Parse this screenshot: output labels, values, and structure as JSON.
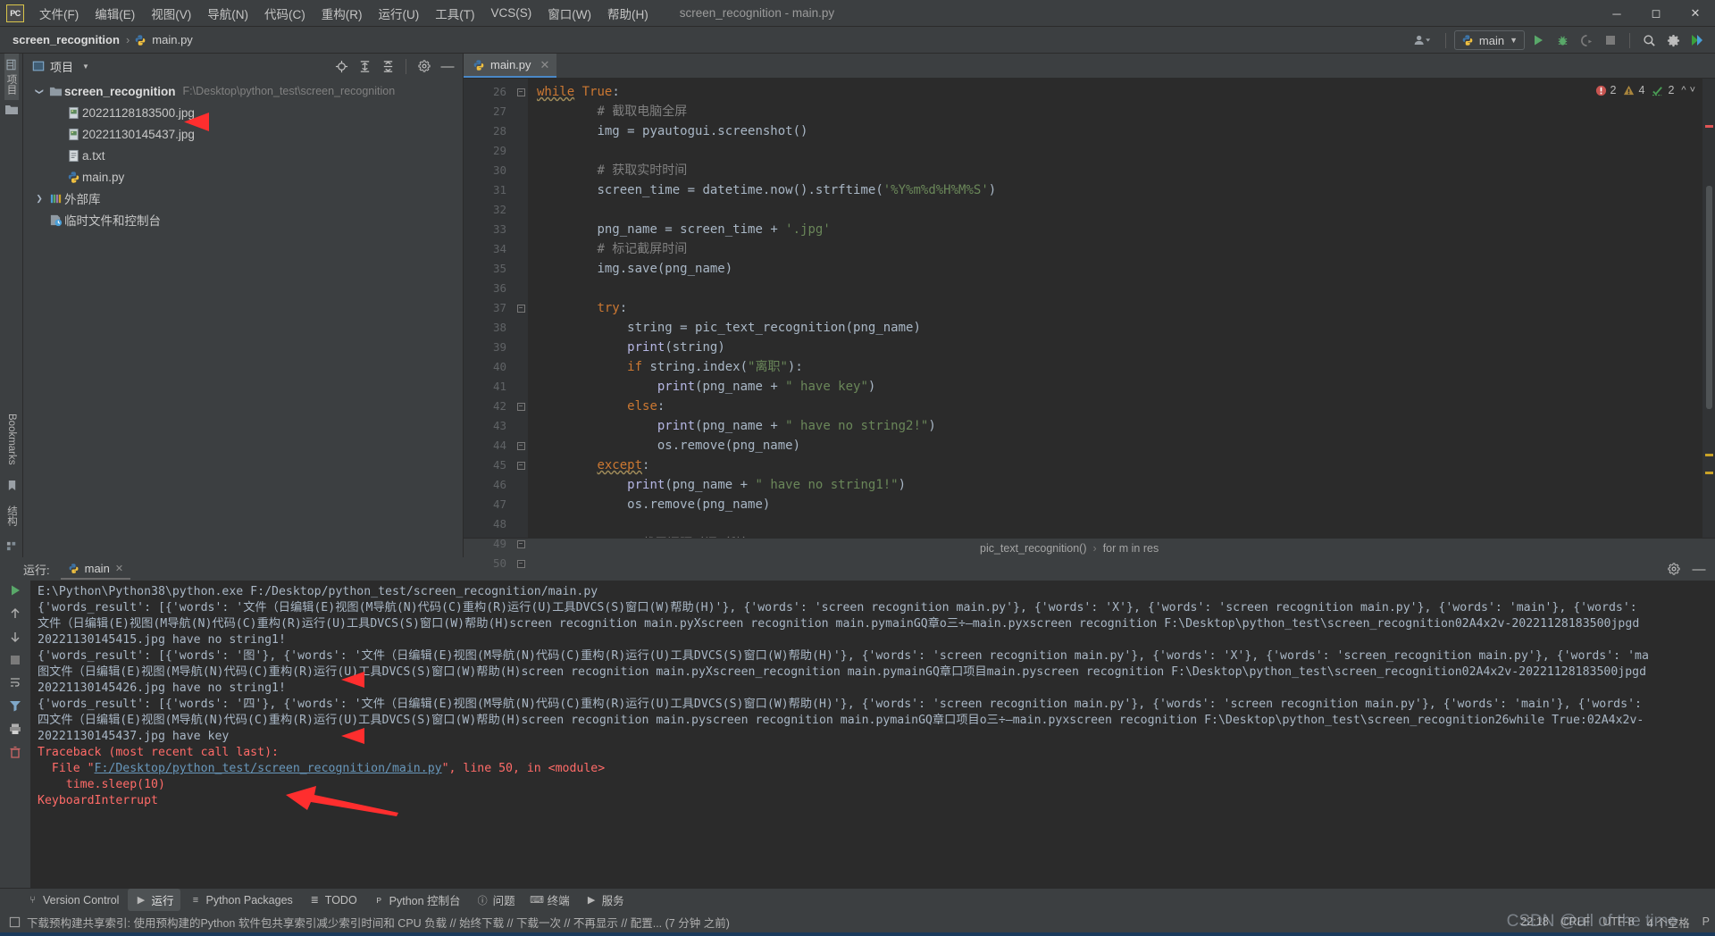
{
  "window": {
    "app_icon": "pycharm-logo-icon",
    "title": "screen_recognition - main.py",
    "controls": [
      "minimize",
      "maximize",
      "close"
    ]
  },
  "menubar": {
    "items": [
      {
        "label": "文件(F)",
        "name": "menu-file"
      },
      {
        "label": "编辑(E)",
        "name": "menu-edit"
      },
      {
        "label": "视图(V)",
        "name": "menu-view"
      },
      {
        "label": "导航(N)",
        "name": "menu-navigate"
      },
      {
        "label": "代码(C)",
        "name": "menu-code"
      },
      {
        "label": "重构(R)",
        "name": "menu-refactor"
      },
      {
        "label": "运行(U)",
        "name": "menu-run"
      },
      {
        "label": "工具(T)",
        "name": "menu-tools"
      },
      {
        "label": "VCS(S)",
        "name": "menu-vcs"
      },
      {
        "label": "窗口(W)",
        "name": "menu-window"
      },
      {
        "label": "帮助(H)",
        "name": "menu-help"
      }
    ]
  },
  "navbar": {
    "breadcrumb": [
      {
        "label": "screen_recognition",
        "icon": ""
      },
      {
        "label": "main.py",
        "icon": "python-file-icon"
      }
    ],
    "separator": "›",
    "run_config": "main",
    "run_config_icon": "python-icon",
    "icons": [
      "account-icon",
      "run-icon",
      "debug-icon",
      "run-with-coverage-icon",
      "stop-icon",
      "search-icon",
      "settings-icon",
      "updates-icon"
    ]
  },
  "left_strip": {
    "tabs": [
      {
        "label": "项目",
        "name": "strip-tab-project",
        "active": true
      }
    ],
    "bottom": [
      {
        "label": "Bookmarks",
        "name": "strip-tab-bookmarks"
      },
      {
        "label": "结构",
        "name": "strip-tab-structure"
      }
    ]
  },
  "project_panel": {
    "title": "项目",
    "title_icon": "project-icon",
    "dropdown_icon": "chevron-down-icon",
    "actions": [
      "locate-icon",
      "expand-all-icon",
      "collapse-all-icon",
      "settings-icon",
      "hide-icon"
    ],
    "tree": [
      {
        "label": "screen_recognition",
        "path": "F:\\Desktop\\python_test\\screen_recognition",
        "icon": "folder-icon",
        "indent": 0,
        "twisty": "expanded",
        "bold": true
      },
      {
        "label": "20221128183500.jpg",
        "path": "",
        "icon": "image-file-icon",
        "indent": 1,
        "twisty": "none",
        "bold": false
      },
      {
        "label": "20221130145437.jpg",
        "path": "",
        "icon": "image-file-icon",
        "indent": 1,
        "twisty": "none",
        "bold": false
      },
      {
        "label": "a.txt",
        "path": "",
        "icon": "text-file-icon",
        "indent": 1,
        "twisty": "none",
        "bold": false
      },
      {
        "label": "main.py",
        "path": "",
        "icon": "python-file-icon",
        "indent": 1,
        "twisty": "none",
        "bold": false
      },
      {
        "label": "外部库",
        "path": "",
        "icon": "library-icon",
        "indent": 0,
        "twisty": "collapsed",
        "bold": false
      },
      {
        "label": "临时文件和控制台",
        "path": "",
        "icon": "scratches-icon",
        "indent": 0,
        "twisty": "none",
        "bold": false
      }
    ]
  },
  "editor": {
    "tabs": [
      {
        "label": "main.py",
        "icon": "python-file-icon",
        "active": true,
        "close_icon": "close-icon"
      }
    ],
    "inspection": {
      "errors": "2",
      "warnings": "4",
      "typos": "2",
      "error_icon": "error-icon",
      "warning_icon": "warning-icon",
      "typo_icon": "typo-icon",
      "up_icon": "chevron-up-icon",
      "down_icon": "chevron-down-icon"
    },
    "first_line_number": 26,
    "lines": [
      {
        "n": 26,
        "fold": "minus",
        "tokens": [
          {
            "t": "while",
            "c": "kw wavy"
          },
          {
            "t": " ",
            "c": "id"
          },
          {
            "t": "True",
            "c": "kw"
          },
          {
            "t": ":",
            "c": "id"
          }
        ],
        "indent": 0
      },
      {
        "n": 27,
        "fold": "",
        "tokens": [
          {
            "t": "# 截取电脑全屏",
            "c": "cmt"
          }
        ],
        "indent": 2
      },
      {
        "n": 28,
        "fold": "",
        "tokens": [
          {
            "t": "img ",
            "c": "id"
          },
          {
            "t": "= ",
            "c": "id"
          },
          {
            "t": "pyautogui",
            "c": "id"
          },
          {
            "t": ".screenshot()",
            "c": "id"
          }
        ],
        "indent": 2
      },
      {
        "n": 29,
        "fold": "",
        "tokens": [],
        "indent": 0
      },
      {
        "n": 30,
        "fold": "",
        "tokens": [
          {
            "t": "# 获取实时时间",
            "c": "cmt"
          }
        ],
        "indent": 2
      },
      {
        "n": 31,
        "fold": "",
        "tokens": [
          {
            "t": "screen_time ",
            "c": "id"
          },
          {
            "t": "= ",
            "c": "id"
          },
          {
            "t": "datetime.now().strftime(",
            "c": "id"
          },
          {
            "t": "'%Y%m%d%H%M%S'",
            "c": "str"
          },
          {
            "t": ")",
            "c": "id"
          }
        ],
        "indent": 2
      },
      {
        "n": 32,
        "fold": "",
        "tokens": [],
        "indent": 0
      },
      {
        "n": 33,
        "fold": "",
        "tokens": [
          {
            "t": "png_name ",
            "c": "id"
          },
          {
            "t": "= ",
            "c": "id"
          },
          {
            "t": "screen_time ",
            "c": "id"
          },
          {
            "t": "+ ",
            "c": "id"
          },
          {
            "t": "'.jpg'",
            "c": "str"
          }
        ],
        "indent": 2
      },
      {
        "n": 34,
        "fold": "",
        "tokens": [
          {
            "t": "# 标记截屏时间",
            "c": "cmt"
          }
        ],
        "indent": 2
      },
      {
        "n": 35,
        "fold": "",
        "tokens": [
          {
            "t": "img.save(png_name)",
            "c": "id"
          }
        ],
        "indent": 2
      },
      {
        "n": 36,
        "fold": "",
        "tokens": [],
        "indent": 0
      },
      {
        "n": 37,
        "fold": "minus",
        "tokens": [
          {
            "t": "try",
            "c": "kw"
          },
          {
            "t": ":",
            "c": "id"
          }
        ],
        "indent": 2
      },
      {
        "n": 38,
        "fold": "",
        "tokens": [
          {
            "t": "string ",
            "c": "id"
          },
          {
            "t": "= ",
            "c": "id"
          },
          {
            "t": "pic_text_recognition(png_name)",
            "c": "id"
          }
        ],
        "indent": 3
      },
      {
        "n": 39,
        "fold": "",
        "tokens": [
          {
            "t": "print",
            "c": "fn"
          },
          {
            "t": "(string)",
            "c": "id"
          }
        ],
        "indent": 3
      },
      {
        "n": 40,
        "fold": "",
        "tokens": [
          {
            "t": "if ",
            "c": "kw"
          },
          {
            "t": "string.index(",
            "c": "id"
          },
          {
            "t": "\"离职\"",
            "c": "str"
          },
          {
            "t": "):",
            "c": "id"
          }
        ],
        "indent": 3
      },
      {
        "n": 41,
        "fold": "",
        "tokens": [
          {
            "t": "print",
            "c": "fn"
          },
          {
            "t": "(png_name ",
            "c": "id"
          },
          {
            "t": "+ ",
            "c": "id"
          },
          {
            "t": "\" have key\"",
            "c": "str"
          },
          {
            "t": ")",
            "c": "id"
          }
        ],
        "indent": 4
      },
      {
        "n": 42,
        "fold": "minus",
        "tokens": [
          {
            "t": "else",
            "c": "kw"
          },
          {
            "t": ":",
            "c": "id"
          }
        ],
        "indent": 3
      },
      {
        "n": 43,
        "fold": "",
        "tokens": [
          {
            "t": "print",
            "c": "fn"
          },
          {
            "t": "(png_name ",
            "c": "id"
          },
          {
            "t": "+ ",
            "c": "id"
          },
          {
            "t": "\" have no string2!\"",
            "c": "str"
          },
          {
            "t": ")",
            "c": "id"
          }
        ],
        "indent": 4
      },
      {
        "n": 44,
        "fold": "minus",
        "tokens": [
          {
            "t": "os.remove(png_name)",
            "c": "id"
          }
        ],
        "indent": 4
      },
      {
        "n": 45,
        "fold": "minus",
        "tokens": [
          {
            "t": "except",
            "c": "kw wavy"
          },
          {
            "t": ":",
            "c": "id"
          }
        ],
        "indent": 2
      },
      {
        "n": 46,
        "fold": "",
        "tokens": [
          {
            "t": "print",
            "c": "fn"
          },
          {
            "t": "(png_name ",
            "c": "id"
          },
          {
            "t": "+ ",
            "c": "id"
          },
          {
            "t": "\" have no string1!\"",
            "c": "str"
          },
          {
            "t": ")",
            "c": "id"
          }
        ],
        "indent": 3
      },
      {
        "n": 47,
        "fold": "",
        "tokens": [
          {
            "t": "os.remove(png_name)",
            "c": "id"
          }
        ],
        "indent": 3
      },
      {
        "n": 48,
        "fold": "",
        "tokens": [],
        "indent": 0
      },
      {
        "n": 49,
        "fold": "minus",
        "tokens": [
          {
            "t": "# 截屏间隔时间（秒）",
            "c": "cmt"
          }
        ],
        "indent": 3
      },
      {
        "n": 50,
        "fold": "minus",
        "tokens": [
          {
            "t": "time.sleep(",
            "c": "id"
          },
          {
            "t": "10",
            "c": "num"
          },
          {
            "t": ")",
            "c": "id"
          }
        ],
        "indent": 2
      }
    ],
    "bottom_breadcrumb": [
      "pic_text_recognition()",
      "for m in res"
    ],
    "bottom_breadcrumb_sep": "›"
  },
  "run_panel": {
    "label": "运行:",
    "tab": "main",
    "tab_icon": "python-icon",
    "tab_close_icon": "close-icon",
    "head_actions": [
      "settings-icon",
      "hide-icon"
    ],
    "toolbar_icons": [
      "rerun-icon",
      "scroll-up-icon",
      "scroll-down-icon",
      "stop-icon",
      "wrap-text-icon",
      "filter-icon",
      "print-icon",
      "clear-all-icon"
    ],
    "console_lines": [
      {
        "text": "E:\\Python\\Python38\\python.exe F:/Desktop/python_test/screen_recognition/main.py",
        "style": "normal"
      },
      {
        "text": "{'words_result': [{'words': '文件（日编辑(E)视图(M导航(N)代码(C)重构(R)运行(U)工具DVCS(S)窗口(W)帮助(H)'}, {'words': 'screen recognition main.py'}, {'words': 'X'}, {'words': 'screen recognition main.py'}, {'words': 'main'}, {'words':",
        "style": "normal"
      },
      {
        "text": "文件（日编辑(E)视图(M导航(N)代码(C)重构(R)运行(U)工具DVCS(S)窗口(W)帮助(H)screen recognition main.pyXscreen recognition main.pymainGQ章o三÷—main.pyxscreen recognition F:\\Desktop\\python_test\\screen_recognition02A4x2v-20221128183500jpgd",
        "style": "normal"
      },
      {
        "text": "20221130145415.jpg have no string1!",
        "style": "normal"
      },
      {
        "text": "{'words_result': [{'words': '图'}, {'words': '文件（日编辑(E)视图(M导航(N)代码(C)重构(R)运行(U)工具DVCS(S)窗口(W)帮助(H)'}, {'words': 'screen recognition main.py'}, {'words': 'X'}, {'words': 'screen_recognition main.py'}, {'words': 'ma",
        "style": "normal"
      },
      {
        "text": "图文件（日编辑(E)视图(M导航(N)代码(C)重构(R)运行(U)工具DVCS(S)窗口(W)帮助(H)screen recognition main.pyXscreen_recognition main.pymainGQ章口项目main.pyscreen recognition F:\\Desktop\\python_test\\screen_recognition02A4x2v-20221128183500jpgd",
        "style": "normal"
      },
      {
        "text": "20221130145426.jpg have no string1!",
        "style": "normal"
      },
      {
        "text": "{'words_result': [{'words': '四'}, {'words': '文件（日编辑(E)视图(M导航(N)代码(C)重构(R)运行(U)工具DVCS(S)窗口(W)帮助(H)'}, {'words': 'screen recognition main.py'}, {'words': 'screen recognition main.py'}, {'words': 'main'}, {'words':",
        "style": "normal"
      },
      {
        "text": "四文件（日编辑(E)视图(M导航(N)代码(C)重构(R)运行(U)工具DVCS(S)窗口(W)帮助(H)screen recognition main.pyscreen recognition main.pymainGQ章口项目o三÷—main.pyxscreen recognition F:\\Desktop\\python_test\\screen_recognition26while True:02A4x2v-",
        "style": "normal"
      },
      {
        "text": "20221130145437.jpg have key",
        "style": "normal"
      },
      {
        "text": "Traceback (most recent call last):",
        "style": "error"
      },
      {
        "text": "  File \"F:/Desktop/python_test/screen_recognition/main.py\", line 50, in <module>",
        "style": "error-link",
        "link": "F:/Desktop/python_test/screen_recognition/main.py",
        "prefix": "  File \"",
        "suffix": "\", line 50, in <module>"
      },
      {
        "text": "    time.sleep(10)",
        "style": "error"
      },
      {
        "text": "KeyboardInterrupt",
        "style": "error"
      }
    ]
  },
  "toolwindow_bar": {
    "items": [
      {
        "label": "Version Control",
        "icon": "branch-icon",
        "active": false,
        "name": "tool-version-control"
      },
      {
        "label": "运行",
        "icon": "run-icon",
        "active": true,
        "name": "tool-run"
      },
      {
        "label": "Python Packages",
        "icon": "packages-icon",
        "active": false,
        "name": "tool-python-packages"
      },
      {
        "label": "TODO",
        "icon": "todo-icon",
        "active": false,
        "name": "tool-todo"
      },
      {
        "label": "Python 控制台",
        "icon": "python-icon",
        "active": false,
        "name": "tool-python-console"
      },
      {
        "label": "问题",
        "icon": "problems-icon",
        "active": false,
        "name": "tool-problems"
      },
      {
        "label": "终端",
        "icon": "terminal-icon",
        "active": false,
        "name": "tool-terminal"
      },
      {
        "label": "服务",
        "icon": "services-icon",
        "active": false,
        "name": "tool-services"
      }
    ]
  },
  "statusbar": {
    "message_icon": "notification-icon",
    "message": "下载预构建共享索引: 使用预构建的Python 软件包共享索引减少索引时间和 CPU 负载 // 始终下载 // 下载一次 // 不再显示 // 配置... (7 分钟 之前)",
    "right": [
      {
        "label": "22:18",
        "name": "status-time"
      },
      {
        "label": "CRLF",
        "name": "status-line-separator"
      },
      {
        "label": "UTF-8",
        "name": "status-encoding"
      },
      {
        "label": "4 个空格",
        "name": "status-indent"
      },
      {
        "label": "P",
        "name": "status-branch"
      }
    ],
    "watermark": "CSDN @all of the time"
  },
  "annotations": {
    "arrow_color": "#ff2e2e",
    "arrows": [
      {
        "name": "arrow-project-file",
        "target": "20221130145437.jpg"
      },
      {
        "name": "arrow-console-line-1",
        "target": "20221130145415.jpg have no string1!"
      },
      {
        "name": "arrow-console-line-2",
        "target": "20221130145426.jpg have no string1!"
      },
      {
        "name": "arrow-console-line-3",
        "target": "20221130145437.jpg have key"
      }
    ]
  }
}
